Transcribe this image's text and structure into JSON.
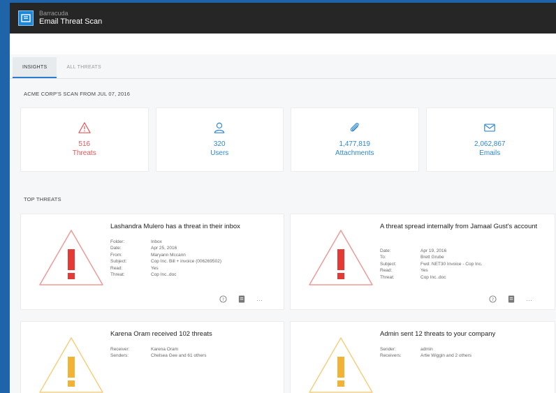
{
  "app": {
    "brand_small": "Barracuda",
    "brand_title": "Email Threat Scan"
  },
  "tabs": [
    {
      "label": "INSIGHTS",
      "active": true
    },
    {
      "label": "ALL THREATS",
      "active": false
    }
  ],
  "scan_title": "ACME CORP'S SCAN FROM JUL 07, 2016",
  "stats": [
    {
      "value": "516",
      "label": "Threats",
      "icon": "warning-icon",
      "color": "#e0565b"
    },
    {
      "value": "320",
      "label": "Users",
      "icon": "user-icon",
      "color": "#2f86d1"
    },
    {
      "value": "1,477,819",
      "label": "Attachments",
      "icon": "paperclip-icon",
      "color": "#2f86d1"
    },
    {
      "value": "2,062,867",
      "label": "Emails",
      "icon": "envelope-icon",
      "color": "#2f86d1"
    }
  ],
  "top_threats_title": "TOP THREATS",
  "threats": [
    {
      "title": "Lashandra Mulero has a threat in their inbox",
      "severity_color": "#e0565b",
      "fields": [
        {
          "k": "Folder:",
          "v": "Inbox"
        },
        {
          "k": "Date:",
          "v": "Apr 25, 2016"
        },
        {
          "k": "From:",
          "v": "Maryann Mccann"
        },
        {
          "k": "Subject:",
          "v": "Cop Inc. Bill + invoice (006269502)"
        },
        {
          "k": "Read:",
          "v": "Yes"
        },
        {
          "k": "Threat:",
          "v": "Cop Inc..doc"
        }
      ]
    },
    {
      "title": "A threat spread internally from Jamaal Gust's account",
      "severity_color": "#e0565b",
      "fields": [
        {
          "k": "Date:",
          "v": "Apr 19, 2016"
        },
        {
          "k": "To:",
          "v": "Brett Grube"
        },
        {
          "k": "Subject:",
          "v": "Fwd: NET30 Invoice - Cop Inc."
        },
        {
          "k": "Read:",
          "v": "Yes"
        },
        {
          "k": "Threat:",
          "v": "Cop Inc..doc"
        }
      ]
    },
    {
      "title": "Karena Oram received 102 threats",
      "severity_color": "#f2b233",
      "fields": [
        {
          "k": "Receiver:",
          "v": "Karena Oram"
        },
        {
          "k": "Senders:",
          "v": "Chelsea Gee and 61 others"
        }
      ]
    },
    {
      "title": "Admin sent 12 threats to your company",
      "severity_color": "#f2b233",
      "fields": [
        {
          "k": "Sender:",
          "v": "admin"
        },
        {
          "k": "Receivers:",
          "v": "Artie Wiggin and 2 others"
        }
      ]
    }
  ],
  "actions": {
    "more": "···"
  }
}
